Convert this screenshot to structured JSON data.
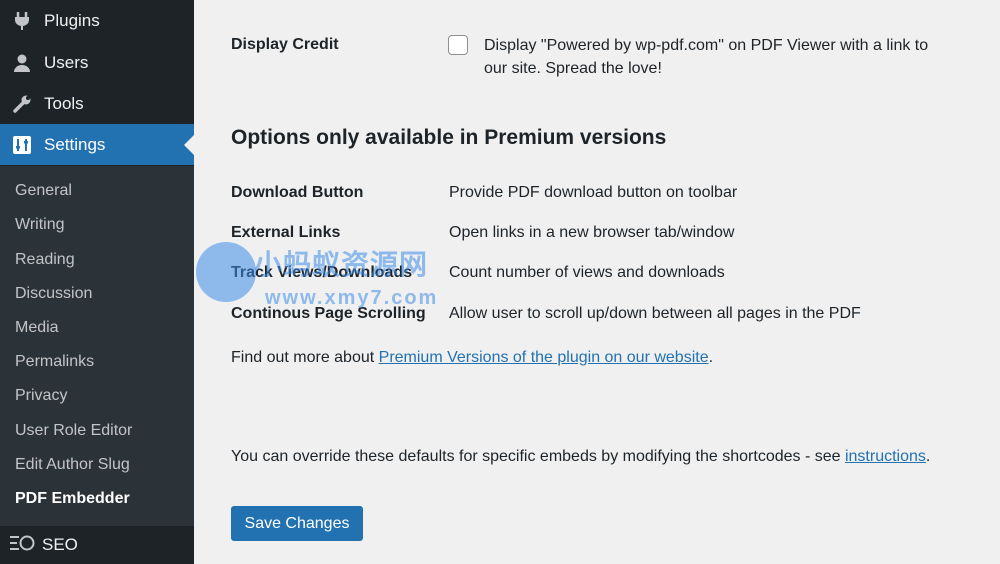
{
  "sidebar": {
    "menu": [
      {
        "label": "Plugins",
        "icon": "plugin-icon"
      },
      {
        "label": "Users",
        "icon": "user-icon"
      },
      {
        "label": "Tools",
        "icon": "wrench-icon"
      },
      {
        "label": "Settings",
        "icon": "settings-icon"
      }
    ],
    "submenu": [
      "General",
      "Writing",
      "Reading",
      "Discussion",
      "Media",
      "Permalinks",
      "Privacy",
      "User Role Editor",
      "Edit Author Slug",
      "PDF Embedder"
    ],
    "seo_label": "SEO"
  },
  "main": {
    "display_credit": {
      "label": "Display Credit",
      "checked": false,
      "line1": "Display \"Powered by wp-pdf.com\" on PDF Viewer with a link to",
      "line2": "our site. Spread the love!"
    },
    "premium_heading": "Options only available in Premium versions",
    "premium_options": [
      {
        "label": "Download Button",
        "desc": "Provide PDF download button on toolbar"
      },
      {
        "label": "External Links",
        "desc": "Open links in a new browser tab/window"
      },
      {
        "label": "Track Views/Downloads",
        "desc": "Count number of views and downloads"
      },
      {
        "label": "Continous Page Scrolling",
        "desc": "Allow user to scroll up/down between all pages in the PDF"
      }
    ],
    "find_out": {
      "prefix": "Find out more about ",
      "link": "Premium Versions of the plugin on our website",
      "suffix": "."
    },
    "override": {
      "prefix": "You can override these defaults for specific embeds by modifying the shortcodes - see ",
      "link": "instructions",
      "suffix": "."
    },
    "save_label": "Save Changes"
  },
  "watermark": {
    "text": "小蚂蚁资源网",
    "url": "www.xmy7.com"
  },
  "colors": {
    "sidebar_bg": "#1d2327",
    "submenu_bg": "#2c3338",
    "accent": "#2271b1",
    "page_bg": "#f0f0f1"
  }
}
